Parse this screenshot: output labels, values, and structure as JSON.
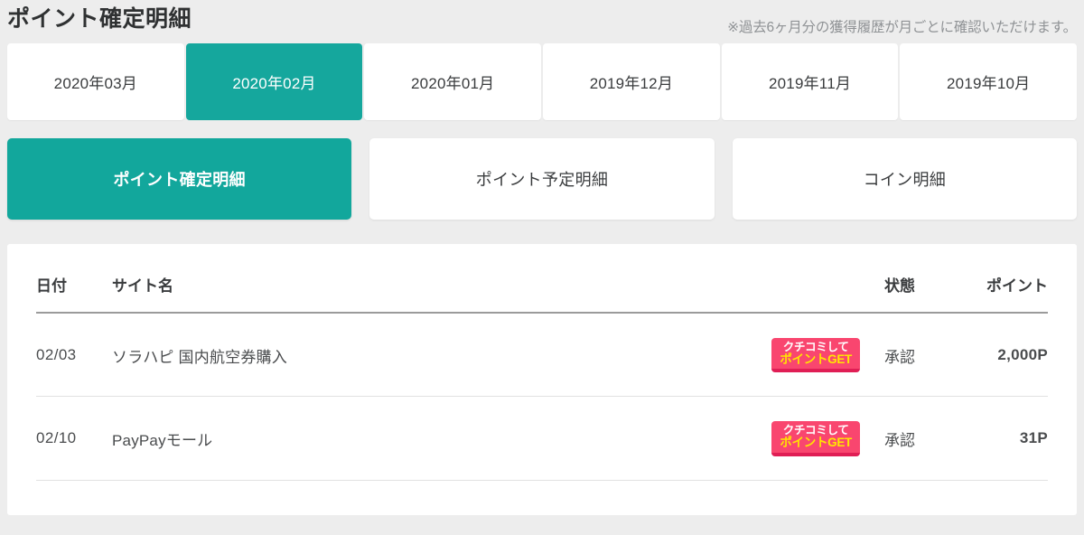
{
  "header": {
    "title": "ポイント確定明細",
    "note": "※過去6ヶ月分の獲得履歴が月ごとに確認いただけます。"
  },
  "theme": {
    "accent": "#15a79d",
    "point_color": "#ef3d38",
    "badge_bg": "#f9466f",
    "badge_accent": "#ffe600",
    "page_bg": "#ededed"
  },
  "month_tabs": [
    {
      "label": "2020年03月",
      "active": false
    },
    {
      "label": "2020年02月",
      "active": true
    },
    {
      "label": "2020年01月",
      "active": false
    },
    {
      "label": "2019年12月",
      "active": false
    },
    {
      "label": "2019年11月",
      "active": false
    },
    {
      "label": "2019年10月",
      "active": false
    }
  ],
  "category_tabs": [
    {
      "label": "ポイント確定明細",
      "active": true
    },
    {
      "label": "ポイント予定明細",
      "active": false
    },
    {
      "label": "コイン明細",
      "active": false
    }
  ],
  "table": {
    "columns": {
      "date": "日付",
      "site": "サイト名",
      "badge": "",
      "state": "状態",
      "point": "ポイント"
    },
    "rows": [
      {
        "date": "02/03",
        "site": "ソラハピ 国内航空券購入",
        "badge_line1": "クチコミして",
        "badge_line2": "ポイントGET",
        "state": "承認",
        "point": "2,000P"
      },
      {
        "date": "02/10",
        "site": "PayPayモール",
        "badge_line1": "クチコミして",
        "badge_line2": "ポイントGET",
        "state": "承認",
        "point": "31P"
      }
    ]
  }
}
